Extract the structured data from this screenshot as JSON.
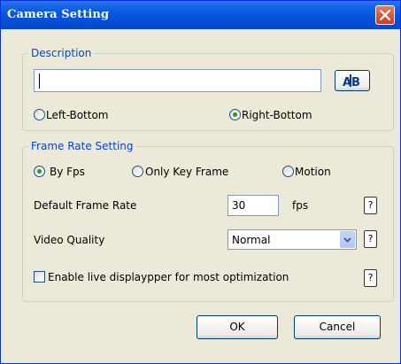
{
  "window": {
    "title": "Camera Setting"
  },
  "description": {
    "legend": "Description",
    "input_value": "",
    "position_options": [
      {
        "label": "Left-Bottom",
        "checked": false
      },
      {
        "label": "Right-Bottom",
        "checked": true
      }
    ]
  },
  "frame_rate": {
    "legend": "Frame Rate Setting",
    "mode_options": [
      {
        "label": "By Fps",
        "checked": true
      },
      {
        "label": "Only Key Frame",
        "checked": false
      },
      {
        "label": "Motion",
        "checked": false
      }
    ],
    "default_rate_label": "Default Frame Rate",
    "default_rate_value": "30",
    "default_rate_unit": "fps",
    "video_quality_label": "Video Quality",
    "video_quality_value": "Normal",
    "live_display_label": "Enable live displaypper for most optimization",
    "live_display_checked": false,
    "help_label": "?"
  },
  "buttons": {
    "ok": "OK",
    "cancel": "Cancel"
  }
}
